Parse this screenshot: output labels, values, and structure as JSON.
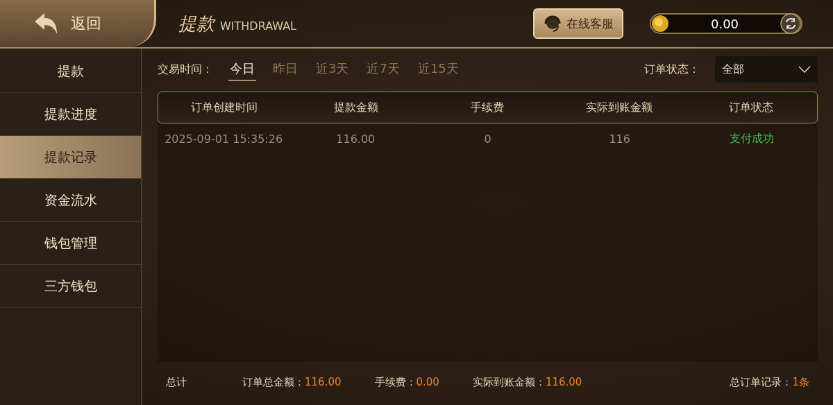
{
  "header": {
    "back_label": "返回",
    "title": "提款",
    "subtitle": "WITHDRAWAL",
    "support_button": "在线客服",
    "balance": "0.00"
  },
  "sidebar": {
    "items": [
      {
        "label": "提款",
        "selected": false
      },
      {
        "label": "提款进度",
        "selected": false
      },
      {
        "label": "提款记录",
        "selected": true
      },
      {
        "label": "资金流水",
        "selected": false
      },
      {
        "label": "钱包管理",
        "selected": false
      },
      {
        "label": "三方钱包",
        "selected": false
      }
    ]
  },
  "filter": {
    "label": "交易时间：",
    "ranges": [
      {
        "label": "今日",
        "selected": true
      },
      {
        "label": "昨日",
        "selected": false
      },
      {
        "label": "近3天",
        "selected": false
      },
      {
        "label": "近7天",
        "selected": false
      },
      {
        "label": "近15天",
        "selected": false
      }
    ],
    "status_label": "订单状态：",
    "status_value": "全部"
  },
  "table": {
    "columns": [
      "订单创建时间",
      "提款金额",
      "手续费",
      "实际到账金额",
      "订单状态"
    ],
    "rows": [
      {
        "cells": [
          "2025-09-01 15:35:26",
          "116.00",
          "0",
          "116"
        ],
        "status": {
          "text": "支付成功",
          "kind": "success"
        }
      }
    ]
  },
  "summary": {
    "label": "总计",
    "items": [
      {
        "label": "订单总金额：",
        "value": "116.00"
      },
      {
        "label": "手续费：",
        "value": "0.00"
      },
      {
        "label": "实际到账金额：",
        "value": "116.00"
      }
    ],
    "record": {
      "label": "总订单记录：",
      "value": "1条"
    }
  }
}
